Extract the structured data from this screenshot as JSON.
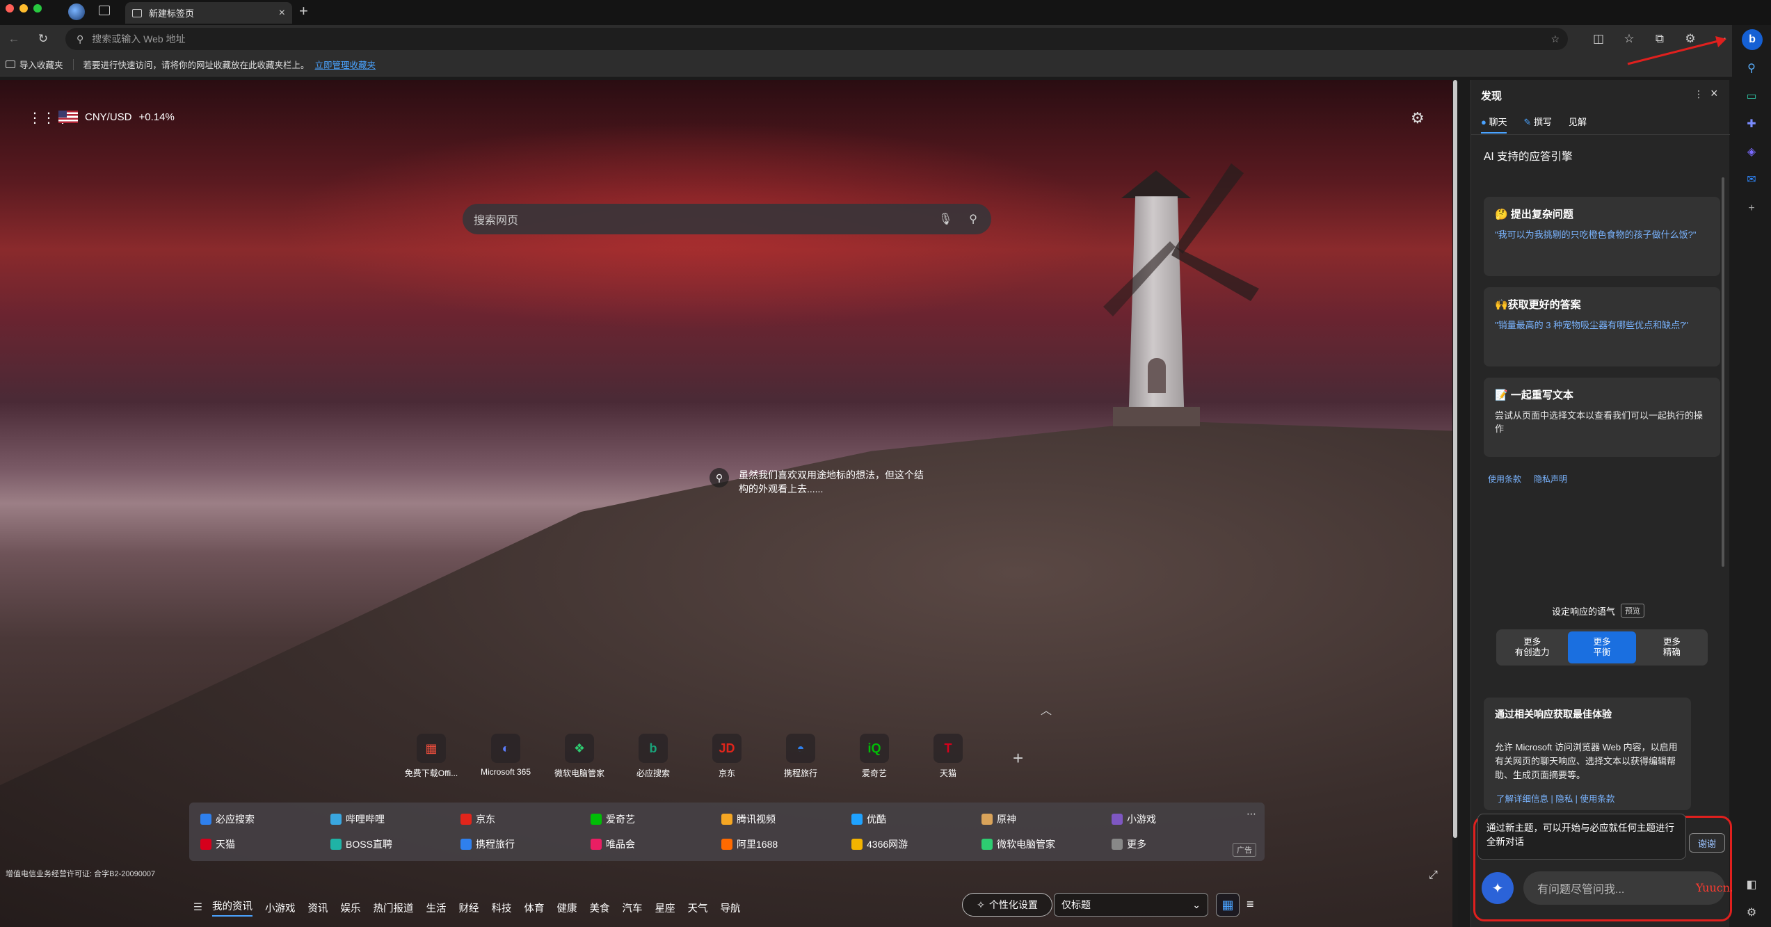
{
  "browser": {
    "tab_title": "新建标签页",
    "tab_close": "×",
    "new_tab": "+",
    "address_placeholder": "搜索或输入 Web 地址"
  },
  "favorites_bar": {
    "import": "导入收藏夹",
    "message": "若要进行快速访问，请将你的网址收藏放在此收藏夹栏上。",
    "manage_link": "立即管理收藏夹"
  },
  "newtab": {
    "currency_pair": "CNY/USD",
    "currency_change": "+0.14%",
    "search_placeholder": "搜索网页",
    "image_caption": "虽然我们喜欢双用途地标的想法，但这个结构的外观看上去......",
    "quick_links": [
      {
        "label": "免费下载Offi...",
        "icon": "office-icon",
        "color": "#e74c3c"
      },
      {
        "label": "Microsoft 365",
        "icon": "microsoft365-icon",
        "color": "#5b7cfa"
      },
      {
        "label": "微软电脑管家",
        "icon": "pc-manager-icon",
        "color": "#2ecc71"
      },
      {
        "label": "必应搜索",
        "icon": "bing-icon",
        "color": "#1aa37a"
      },
      {
        "label": "京东",
        "icon": "jd-icon",
        "color": "#e1251b"
      },
      {
        "label": "携程旅行",
        "icon": "ctrip-icon",
        "color": "#2f80ed"
      },
      {
        "label": "爱奇艺",
        "icon": "iqiyi-icon",
        "color": "#00be06"
      },
      {
        "label": "天猫",
        "icon": "tmall-icon",
        "color": "#d6001c"
      }
    ],
    "quick_link_glyphs": [
      "▦",
      "◐",
      "❖",
      "b",
      "JD",
      "◓",
      "iQ",
      "T"
    ],
    "sites_row1": [
      "必应搜索",
      "哔哩哔哩",
      "京东",
      "爱奇艺",
      "腾讯视频",
      "优酷",
      "原神",
      "小游戏"
    ],
    "sites_row2": [
      "天猫",
      "BOSS直聘",
      "携程旅行",
      "唯品会",
      "阿里1688",
      "4366网游",
      "微软电脑管家",
      "更多"
    ],
    "sites_colors_row1": [
      "#2f80ed",
      "#3aa7e0",
      "#e1251b",
      "#00be06",
      "#f5a623",
      "#1fa2ff",
      "#d9a35a",
      "#7e57c2"
    ],
    "sites_colors_row2": [
      "#d6001c",
      "#1fb3a6",
      "#2f80ed",
      "#e91e63",
      "#ff6a00",
      "#f4b400",
      "#2ecc71",
      "#888888"
    ],
    "ad_label": "广告",
    "license": "增值电信业务经营许可证: 合字B2-20090007",
    "bottom_nav": [
      "我的资讯",
      "小游戏",
      "资讯",
      "娱乐",
      "热门报道",
      "生活",
      "财经",
      "科技",
      "体育",
      "健康",
      "美食",
      "汽车",
      "星座",
      "天气",
      "导航"
    ],
    "personalize": "个性化设置",
    "title_only": "仅标题"
  },
  "sidebar": {
    "header": "发现",
    "tabs": [
      "聊天",
      "撰写",
      "见解"
    ],
    "title": "AI 支持的应答引擎",
    "cards": [
      {
        "title": "🤔 提出复杂问题",
        "text": "\"我可以为我挑剔的只吃橙色食物的孩子做什么饭?\""
      },
      {
        "title": "🙌获取更好的答案",
        "text": "\"销量最高的 3 种宠物吸尘器有哪些优点和缺点?\""
      },
      {
        "title": "📝 一起重写文本",
        "text": "尝试从页面中选择文本以查看我们可以一起执行的操作"
      }
    ],
    "terms": "使用条款",
    "privacy": "隐私声明",
    "tone_label": "设定响应的语气",
    "preview": "预览",
    "tones": [
      {
        "line1": "更多",
        "line2": "有创造力"
      },
      {
        "line1": "更多",
        "line2": "平衡"
      },
      {
        "line1": "更多",
        "line2": "精确"
      }
    ],
    "permission_title": "通过相关响应获取最佳体验",
    "permission_text": "允许 Microsoft 访问浏览器 Web 内容，以启用有关网页的聊天响应、选择文本以获得编辑帮助、生成页面摘要等。",
    "permission_links": "了解详细信息 | 隐私 | 使用条款",
    "new_topic_tip": "通过新主题，可以开始与必应就任何主题进行全新对话",
    "thanks": "谢谢",
    "chat_placeholder": "有问题尽管问我..."
  },
  "watermark": "Yuucn.com",
  "colors": {
    "accent": "#4aa3ff",
    "highlight_border": "#e0201e",
    "tone_active": "#1a6fe0"
  }
}
